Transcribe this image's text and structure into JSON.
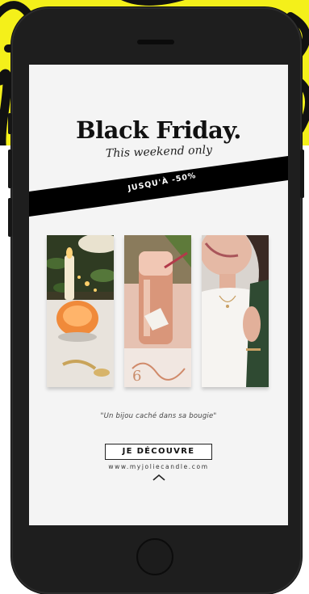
{
  "ad": {
    "title": "Black Friday.",
    "subtitle": "This weekend only",
    "banner_text": "JUSQU'À -50%",
    "quote": "\"Un bijou caché dans sa bougie\"",
    "cta_label": "JE DÉCOUVRE",
    "website": "www.myjoliecandle.com"
  },
  "icons": {
    "scroll_up": "chevron-up-icon"
  },
  "colors": {
    "background_top": "#f4f01a",
    "phone_body": "#1e1e1e",
    "screen_bg": "#f4f4f4",
    "banner_bg": "#000000",
    "accent_rose_gold": "#d89a7a"
  }
}
